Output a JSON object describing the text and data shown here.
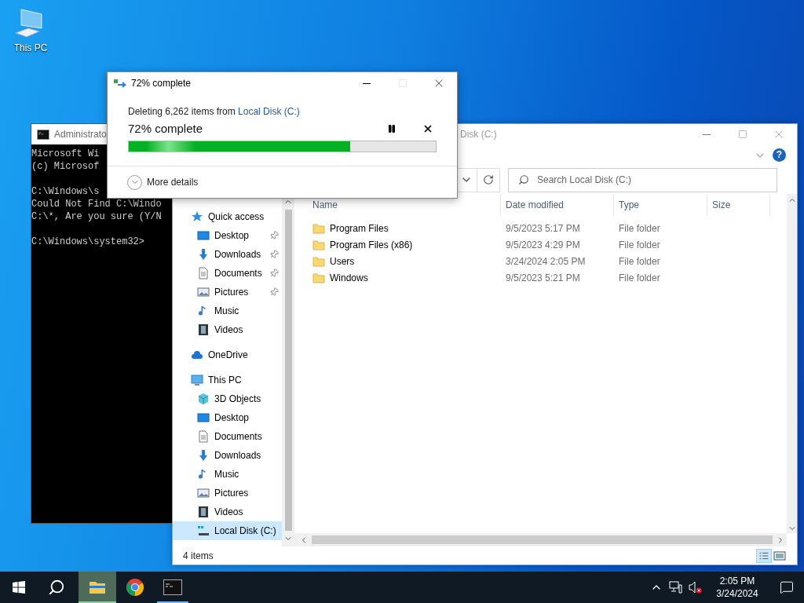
{
  "desktop_icons": [
    {
      "label": "This PC"
    }
  ],
  "cmd": {
    "title": "Administrato",
    "blocks": [
      [
        "Microsoft Wi",
        "(c) Microsof"
      ],
      [
        "C:\\Windows\\s",
        "Could Not Find C:\\Windo",
        "C:\\*, Are you sure (Y/N"
      ],
      [
        "C:\\Windows\\system32>"
      ]
    ]
  },
  "help_label": "?",
  "explorer": {
    "title": "Disk (C:)",
    "search": {
      "placeholder": "Search Local Disk (C:)"
    },
    "columns": [
      "Name",
      "Date modified",
      "Type",
      "Size"
    ],
    "rows": [
      {
        "name": "Program Files",
        "date": "9/5/2023 5:17 PM",
        "type": "File folder"
      },
      {
        "name": "Program Files (x86)",
        "date": "9/5/2023 4:29 PM",
        "type": "File folder"
      },
      {
        "name": "Users",
        "date": "3/24/2024 2:05 PM",
        "type": "File folder"
      },
      {
        "name": "Windows",
        "date": "9/5/2023 5:21 PM",
        "type": "File folder"
      }
    ],
    "nav": [
      {
        "label": "Quick access",
        "kind": "star",
        "selected": false,
        "children": [
          {
            "label": "Desktop",
            "kind": "desktop",
            "pinned": true,
            "selected": false
          },
          {
            "label": "Downloads",
            "kind": "download",
            "pinned": true,
            "selected": false
          },
          {
            "label": "Documents",
            "kind": "document",
            "pinned": true,
            "selected": false
          },
          {
            "label": "Pictures",
            "kind": "picture",
            "pinned": true,
            "selected": false
          },
          {
            "label": "Music",
            "kind": "music",
            "pinned": false,
            "selected": false
          },
          {
            "label": "Videos",
            "kind": "video",
            "pinned": false,
            "selected": false
          }
        ]
      },
      {
        "label": "OneDrive",
        "kind": "cloud",
        "selected": false
      },
      {
        "label": "This PC",
        "kind": "pc",
        "selected": false,
        "children": [
          {
            "label": "3D Objects",
            "kind": "cube",
            "pinned": false,
            "selected": false
          },
          {
            "label": "Desktop",
            "kind": "desktop",
            "pinned": false,
            "selected": false
          },
          {
            "label": "Documents",
            "kind": "document",
            "pinned": false,
            "selected": false
          },
          {
            "label": "Downloads",
            "kind": "download",
            "pinned": false,
            "selected": false
          },
          {
            "label": "Music",
            "kind": "music",
            "pinned": false,
            "selected": false
          },
          {
            "label": "Pictures",
            "kind": "picture",
            "pinned": false,
            "selected": false
          },
          {
            "label": "Videos",
            "kind": "video",
            "pinned": false,
            "selected": false
          },
          {
            "label": "Local Disk (C:)",
            "kind": "drive",
            "pinned": false,
            "selected": true
          }
        ]
      }
    ],
    "status": "4 items"
  },
  "dialog": {
    "title": "72% complete",
    "message": "Deleting 6,262 items from",
    "link": "Local Disk (C:)",
    "heading": "72% complete",
    "progress": {
      "level": 0.72
    },
    "more": "More details"
  },
  "taskbar": {
    "apps": [
      {
        "kind": "explorer",
        "selected": true,
        "running": true
      },
      {
        "kind": "chrome",
        "selected": false,
        "running": false
      },
      {
        "kind": "cmd",
        "selected": false,
        "running": true
      }
    ],
    "time": "2:05 PM",
    "date": "3/24/2024"
  }
}
